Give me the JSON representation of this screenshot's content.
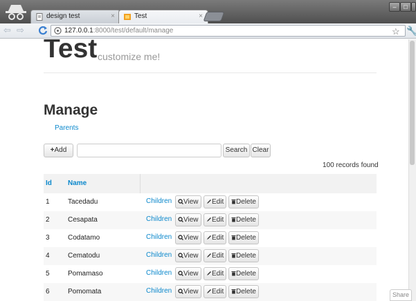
{
  "browser": {
    "tabs": [
      {
        "title": "design test",
        "close": "×"
      },
      {
        "title": "Test",
        "close": "×"
      }
    ],
    "window_buttons": [
      "–",
      "□",
      "×"
    ],
    "url_host": "127.0.0.1",
    "url_rest": ":8000/test/default/manage",
    "back": "⇦",
    "forward": "⇨",
    "star": "☆",
    "wrench": "🔧"
  },
  "page": {
    "brand": "Test",
    "tagline": "customize me!",
    "heading": "Manage",
    "parents_link": "Parents",
    "add_label": "Add",
    "search_label": "Search",
    "clear_label": "Clear",
    "search_value": "",
    "records_found": "100 records found",
    "columns": [
      "Id",
      "Name"
    ],
    "rows": [
      {
        "id": "1",
        "name": "Tacedadu"
      },
      {
        "id": "2",
        "name": "Cesapata"
      },
      {
        "id": "3",
        "name": "Codatamo"
      },
      {
        "id": "4",
        "name": "Cematodu"
      },
      {
        "id": "5",
        "name": "Pomamaso"
      },
      {
        "id": "6",
        "name": "Pomomata"
      }
    ],
    "row_actions": {
      "children": "Children",
      "view": "View",
      "edit": "Edit",
      "delete": "Delete"
    },
    "share_label": "Share"
  },
  "colors": {
    "link": "#0b88cc",
    "header_bg": "#f2f2f2"
  }
}
